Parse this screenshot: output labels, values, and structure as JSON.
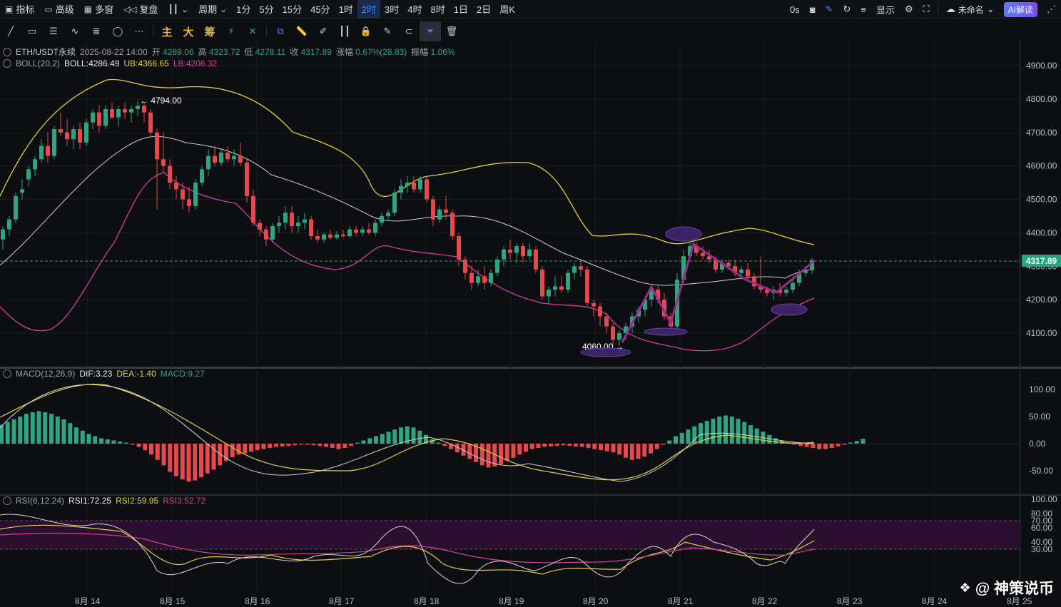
{
  "toolbar": {
    "indicators": "指标",
    "advanced": "高级",
    "multi_window": "多窗",
    "replay": "复盘",
    "period": "周期",
    "periods": [
      "1分",
      "5分",
      "15分",
      "45分",
      "1时",
      "2时",
      "3时",
      "4时",
      "8时",
      "1日",
      "2日",
      "周K"
    ],
    "active_period": "2时",
    "right": {
      "countdown": "0s",
      "display": "显示",
      "layout_name": "未命名",
      "ai": "AI解读"
    }
  },
  "drawbar": {
    "main": "主",
    "big": "大",
    "chip": "筹"
  },
  "legend_main": {
    "symbol": "ETH/USDT永续",
    "datetime": "2025-08-22 14:00",
    "open_label": "开",
    "open": "4289.06",
    "high_label": "高",
    "high": "4323.72",
    "low_label": "低",
    "low": "4278.11",
    "close_label": "收",
    "close": "4317.89",
    "change_label": "涨幅",
    "change": "0.67%(28.83)",
    "amp_label": "振幅",
    "amp": "1.06%"
  },
  "legend_boll": {
    "name": "BOLL(20,2)",
    "boll": "BOLL:4286.49",
    "ub": "UB:4366.65",
    "lb": "LB:4206.32"
  },
  "legend_macd": {
    "name": "MACD(12,26,9)",
    "dif": "DIF:3.23",
    "dea": "DEA:-1.40",
    "macd": "MACD:9.27"
  },
  "legend_rsi": {
    "name": "RSI(6,12,24)",
    "rsi1": "RSI1:72.25",
    "rsi2": "RSI2:59.95",
    "rsi3": "RSI3:52.72"
  },
  "annotations": {
    "high_mark": "← 4794.00",
    "low_mark": "4060.00 →"
  },
  "price_axis": [
    "4900.00",
    "4800.00",
    "4700.00",
    "4600.00",
    "4500.00",
    "4400.00",
    "4300.00",
    "4200.00",
    "4100.00"
  ],
  "current_price": "4317.89",
  "macd_axis": [
    "100.00",
    "50.00",
    "0.00",
    "-50.00"
  ],
  "rsi_axis": [
    "100.00",
    "80.00",
    "70.00",
    "60.00",
    "40.00",
    "30.00"
  ],
  "x_axis": [
    "8月 14",
    "8月 15",
    "8月 16",
    "8月 17",
    "8月 18",
    "8月 19",
    "8月 20",
    "8月 21",
    "8月 22",
    "8月 23",
    "8月 24",
    "8月 25"
  ],
  "watermark": "@ 神策说币",
  "colors": {
    "up": "#2fa57f",
    "down": "#e5484d",
    "boll_ub": "#e3cf3a",
    "boll_lb": "#d43fa0",
    "boll_mid": "#cfcfcf",
    "pattern": "#9b2a8e",
    "active": "#3d8bff"
  }
}
